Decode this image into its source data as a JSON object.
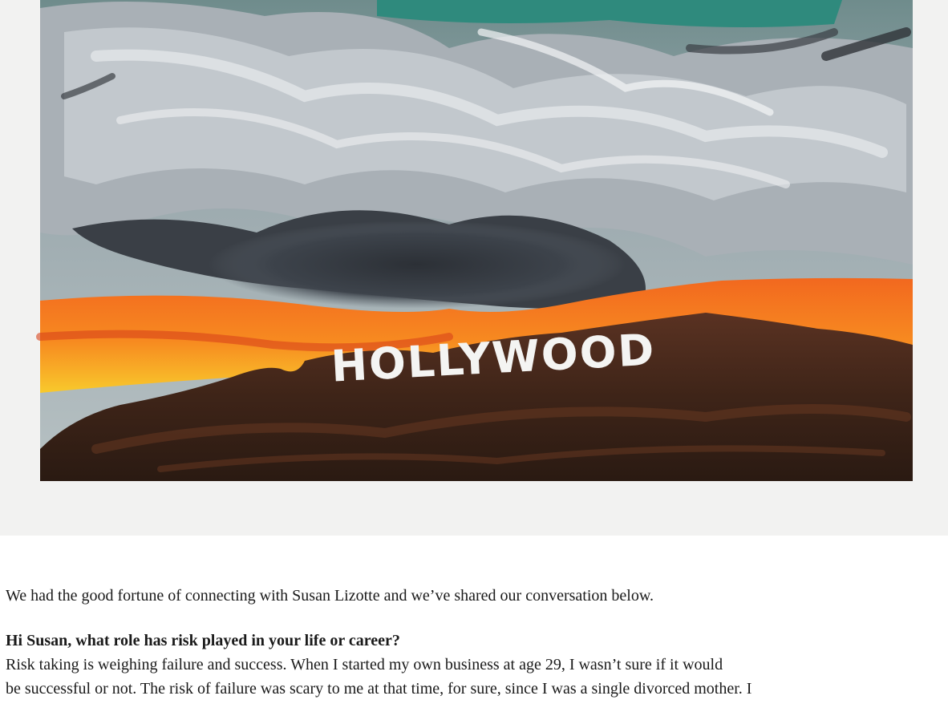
{
  "hero": {
    "sign_text": "HOLLYWOOD"
  },
  "article": {
    "intro": "We had the good fortune of connecting with Susan Lizotte and we’ve shared our conversation below.",
    "question": "Hi Susan, what role has risk played in your life or career?",
    "answer_line_1": "Risk taking is weighing failure and success. When I started my own business at age 29, I wasn’t sure if it would",
    "answer_line_2": "be successful or not. The risk of failure was scary to me at that time, for sure, since I was a single divorced mother. I"
  }
}
